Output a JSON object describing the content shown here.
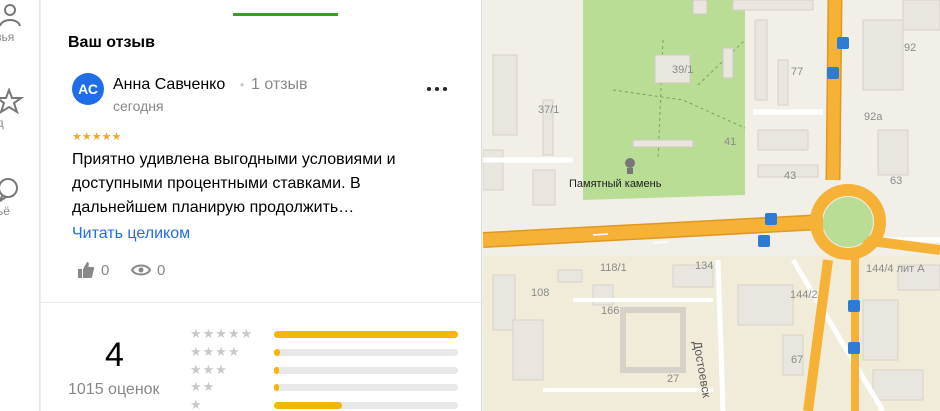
{
  "rail": {
    "items": [
      {
        "label": "узья",
        "icon": "friends-icon"
      },
      {
        "label": "ид",
        "icon": "star-icon"
      },
      {
        "label": "льё",
        "icon": "chat-icon"
      }
    ]
  },
  "review": {
    "section_title": "Ваш отзыв",
    "avatar_initials": "АС",
    "author": "Анна Савченко",
    "author_reviews": "1 отзыв",
    "date": "сегодня",
    "stars": 5,
    "text": "Приятно удивлена выгодными условиями и доступными процентными ставками. В дальнейшем планирую продолжить…",
    "read_more": "Читать целиком",
    "likes": "0",
    "views": "0"
  },
  "rating": {
    "value": "4",
    "count_text": "1015 оценок",
    "distribution": [
      {
        "stars": 5,
        "fraction": 1.0
      },
      {
        "stars": 4,
        "fraction": 0.03
      },
      {
        "stars": 3,
        "fraction": 0.02
      },
      {
        "stars": 2,
        "fraction": 0.02
      },
      {
        "stars": 1,
        "fraction": 0.37
      }
    ]
  },
  "map": {
    "poi_label": "Памятный камень",
    "street_label": "Достоевск",
    "house_numbers": [
      "39/1",
      "37/1",
      "77",
      "92",
      "92а",
      "41",
      "43",
      "63",
      "118/1",
      "134",
      "108",
      "144/4 лит А",
      "144/2",
      "166",
      "67",
      "27"
    ],
    "colors": {
      "background": "#f2efe9",
      "park": "#b9dd94",
      "road": "#f5b236",
      "building": "#e9e6df",
      "building_stroke": "#d6d2c8",
      "transit": "#2e7bd6"
    }
  }
}
